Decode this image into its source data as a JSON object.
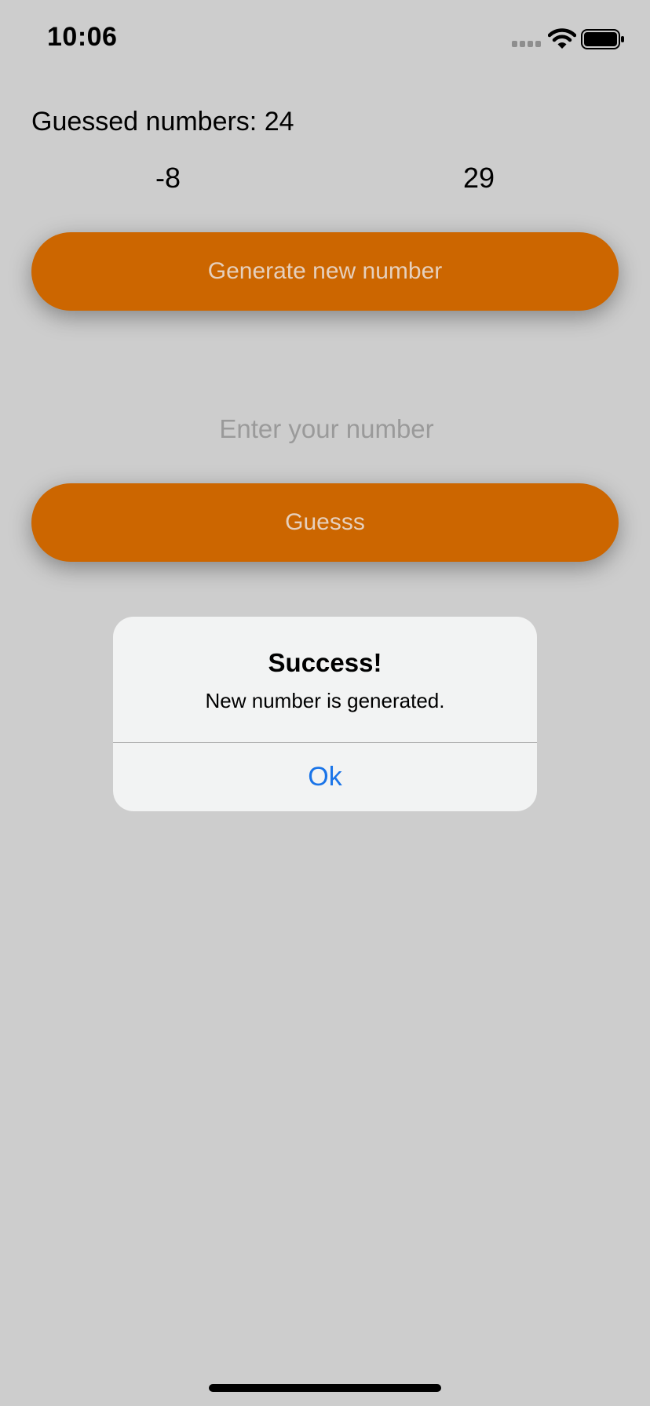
{
  "status_bar": {
    "time": "10:06"
  },
  "game": {
    "guessed_label": "Guessed numbers: 24",
    "range_min": "-8",
    "range_max": "29",
    "generate_button_label": "Generate new number",
    "input_placeholder": "Enter your number",
    "input_value": "",
    "guess_button_label": "Guesss"
  },
  "alert": {
    "title": "Success!",
    "message": "New number is generated.",
    "ok_label": "Ok"
  },
  "colors": {
    "background": "#cdcdcd",
    "button_orange": "#cc6600",
    "button_text": "#e6d0bd",
    "alert_background": "#f2f3f3",
    "alert_action_blue": "#1a74e8"
  },
  "icons": [
    "signal-icon",
    "wifi-icon",
    "battery-icon"
  ]
}
